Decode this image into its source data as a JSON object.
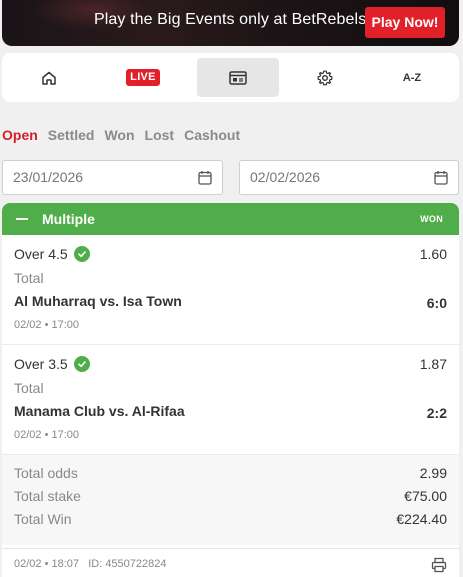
{
  "banner": {
    "text": "Play the Big Events only at BetRebels",
    "button": "Play Now!"
  },
  "nav": {
    "items": [
      {
        "name": "home",
        "icon": "home-icon"
      },
      {
        "name": "live",
        "label": "LIVE"
      },
      {
        "name": "bets",
        "icon": "betslip-icon",
        "active": true
      },
      {
        "name": "settings",
        "icon": "gear-icon"
      },
      {
        "name": "az",
        "label": "A-Z"
      }
    ]
  },
  "tabs": [
    "Open",
    "Settled",
    "Won",
    "Lost",
    "Cashout"
  ],
  "active_tab": "Open",
  "filters": {
    "date_from": "23/01/2026",
    "date_to": "02/02/2026"
  },
  "bet": {
    "type": "Multiple",
    "status": "WON",
    "selections": [
      {
        "market": "Over 4.5",
        "odds": "1.60",
        "label": "Total",
        "match": "Al Muharraq vs. Isa Town",
        "score": "6:0",
        "time": "02/02 • 17:00"
      },
      {
        "market": "Over 3.5",
        "odds": "1.87",
        "label": "Total",
        "match": "Manama Club vs. Al-Rifaa",
        "score": "2:2",
        "time": "02/02 • 17:00"
      }
    ],
    "summary": {
      "total_odds_label": "Total odds",
      "total_odds": "2.99",
      "total_stake_label": "Total stake",
      "total_stake": "€75.00",
      "total_win_label": "Total Win",
      "total_win": "€224.40"
    },
    "footer": {
      "datetime": "02/02 • 18:07",
      "id_label": "ID: 4550722824"
    }
  },
  "colors": {
    "accent_red": "#e2202a",
    "won_green": "#4fae4a"
  }
}
